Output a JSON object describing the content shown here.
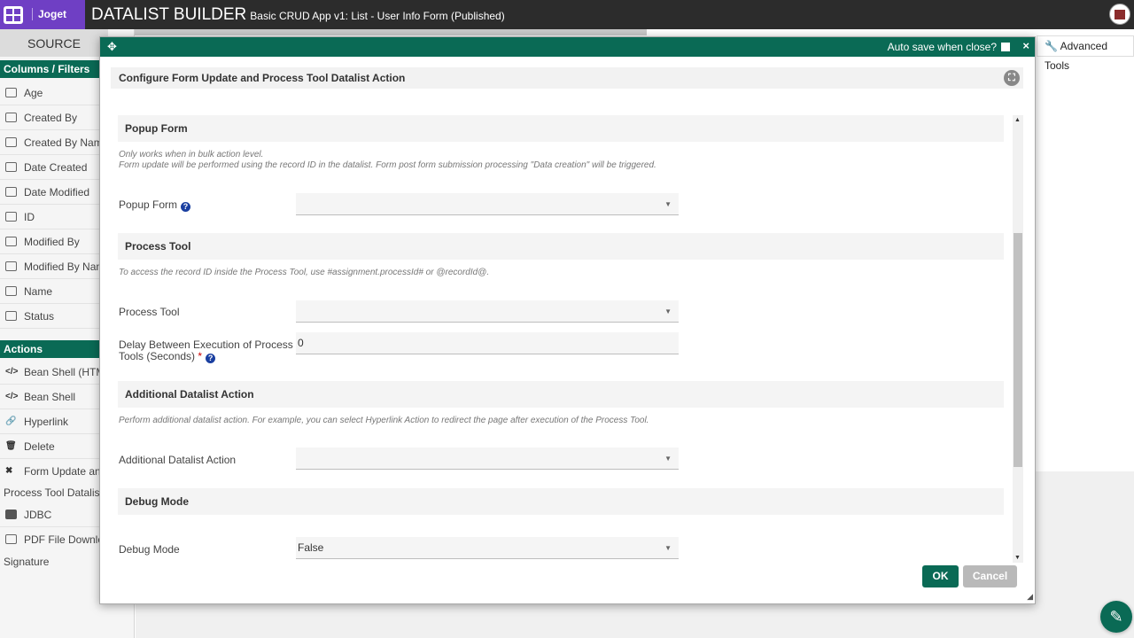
{
  "header": {
    "logo_text": "Joget",
    "title": "DATALIST BUILDER",
    "subtitle": "Basic CRUD App v1: List - User Info Form (Published)"
  },
  "left_panel": {
    "source_tab": "SOURCE",
    "columns_header": "Columns / Filters",
    "columns": [
      "Age",
      "Created By",
      "Created By Name",
      "Date Created",
      "Date Modified",
      "ID",
      "Modified By",
      "Modified By Name",
      "Name",
      "Status"
    ],
    "actions_header": "Actions",
    "actions": {
      "bean_shell_html": "Bean Shell (HTML",
      "bean_shell": "Bean Shell",
      "hyperlink": "Hyperlink",
      "delete": "Delete",
      "form_update_1": "Form Update and",
      "form_update_2": "Process Tool Datalist A",
      "jdbc": "JDBC",
      "pdf_1": "PDF File Downloa",
      "pdf_2": "Signature"
    }
  },
  "advanced_tools": "Advanced Tools",
  "dialog": {
    "autosave_label": "Auto save when close?",
    "close": "×",
    "heading": "Configure Form Update and Process Tool Datalist Action",
    "sections": {
      "popup": {
        "title": "Popup Form",
        "note1": "Only works when in bulk action level.",
        "note2": "Form update will be performed using the record ID in the datalist. Form post form submission processing \"Data creation\" will be triggered.",
        "field_label": "Popup Form",
        "field_value": ""
      },
      "process": {
        "title": "Process Tool",
        "note": "To access the record ID inside the Process Tool, use #assignment.processId# or @recordId@.",
        "tool_label": "Process Tool",
        "tool_value": "",
        "delay_label_1": "Delay Between Execution of Process",
        "delay_label_2": "Tools (Seconds)",
        "delay_value": "0"
      },
      "additional": {
        "title": "Additional Datalist Action",
        "note": "Perform additional datalist action. For example, you can select Hyperlink Action to redirect the page after execution of the Process Tool.",
        "field_label": "Additional Datalist Action",
        "field_value": ""
      },
      "debug": {
        "title": "Debug Mode",
        "field_label": "Debug Mode",
        "field_value": "False"
      }
    },
    "ok": "OK",
    "cancel": "Cancel"
  },
  "colors": {
    "accent": "#0a6a55",
    "brand": "#6f3fc4",
    "header": "#2c2c2c"
  },
  "icons": [
    "app-grid-icon",
    "move-icon",
    "fullscreen-icon",
    "help-icon",
    "wrench-icon",
    "pencil-icon"
  ]
}
